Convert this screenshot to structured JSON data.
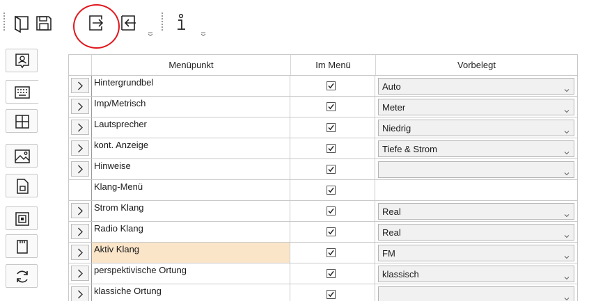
{
  "toolbar": {
    "buttons": [
      {
        "name": "open-icon"
      },
      {
        "name": "save-icon"
      },
      {
        "name": "export-icon"
      },
      {
        "name": "import-icon"
      },
      {
        "name": "info-icon"
      }
    ],
    "overflow_glyph": "⩡"
  },
  "sidebar": {
    "items": [
      {
        "icon": "contact-card-icon",
        "active": false
      },
      {
        "icon": "keyboard-icon",
        "active": true
      },
      {
        "icon": "grid-icon",
        "active": false
      },
      {
        "icon": "image-icon",
        "active": false
      },
      {
        "icon": "document-icon",
        "active": false
      },
      {
        "icon": "chip-icon",
        "active": false
      },
      {
        "icon": "sd-card-icon",
        "active": false
      },
      {
        "icon": "refresh-icon",
        "active": false
      }
    ]
  },
  "grid": {
    "headers": {
      "menu_item": "Menüpunkt",
      "in_menu": "Im Menü",
      "preset": "Vorbelegt"
    },
    "rows": [
      {
        "label": "Hintergrundbel",
        "expandable": true,
        "checked": true,
        "value": "Auto",
        "has_combo": true,
        "highlight": false
      },
      {
        "label": "Imp/Metrisch",
        "expandable": true,
        "checked": true,
        "value": "Meter",
        "has_combo": true,
        "highlight": false
      },
      {
        "label": "Lautsprecher",
        "expandable": true,
        "checked": true,
        "value": "Niedrig",
        "has_combo": true,
        "highlight": false
      },
      {
        "label": "kont. Anzeige",
        "expandable": true,
        "checked": true,
        "value": "Tiefe & Strom",
        "has_combo": true,
        "highlight": false
      },
      {
        "label": "Hinweise",
        "expandable": true,
        "checked": true,
        "value": "",
        "has_combo": true,
        "highlight": false
      },
      {
        "label": "Klang-Menü",
        "expandable": false,
        "checked": true,
        "value": "",
        "has_combo": false,
        "highlight": false
      },
      {
        "label": "Strom Klang",
        "expandable": true,
        "checked": true,
        "value": "Real",
        "has_combo": true,
        "highlight": false
      },
      {
        "label": "Radio Klang",
        "expandable": true,
        "checked": true,
        "value": "Real",
        "has_combo": true,
        "highlight": false
      },
      {
        "label": "Aktiv Klang",
        "expandable": true,
        "checked": true,
        "value": "FM",
        "has_combo": true,
        "highlight": true
      },
      {
        "label": "perspektivische Ortung",
        "expandable": true,
        "checked": true,
        "value": "klassisch",
        "has_combo": true,
        "highlight": false
      },
      {
        "label": "klassiche Ortung",
        "expandable": true,
        "checked": true,
        "value": "",
        "has_combo": true,
        "highlight": false
      }
    ]
  },
  "colors": {
    "highlight_row": "#fbe5c9",
    "annotation_circle": "#e0161d"
  }
}
